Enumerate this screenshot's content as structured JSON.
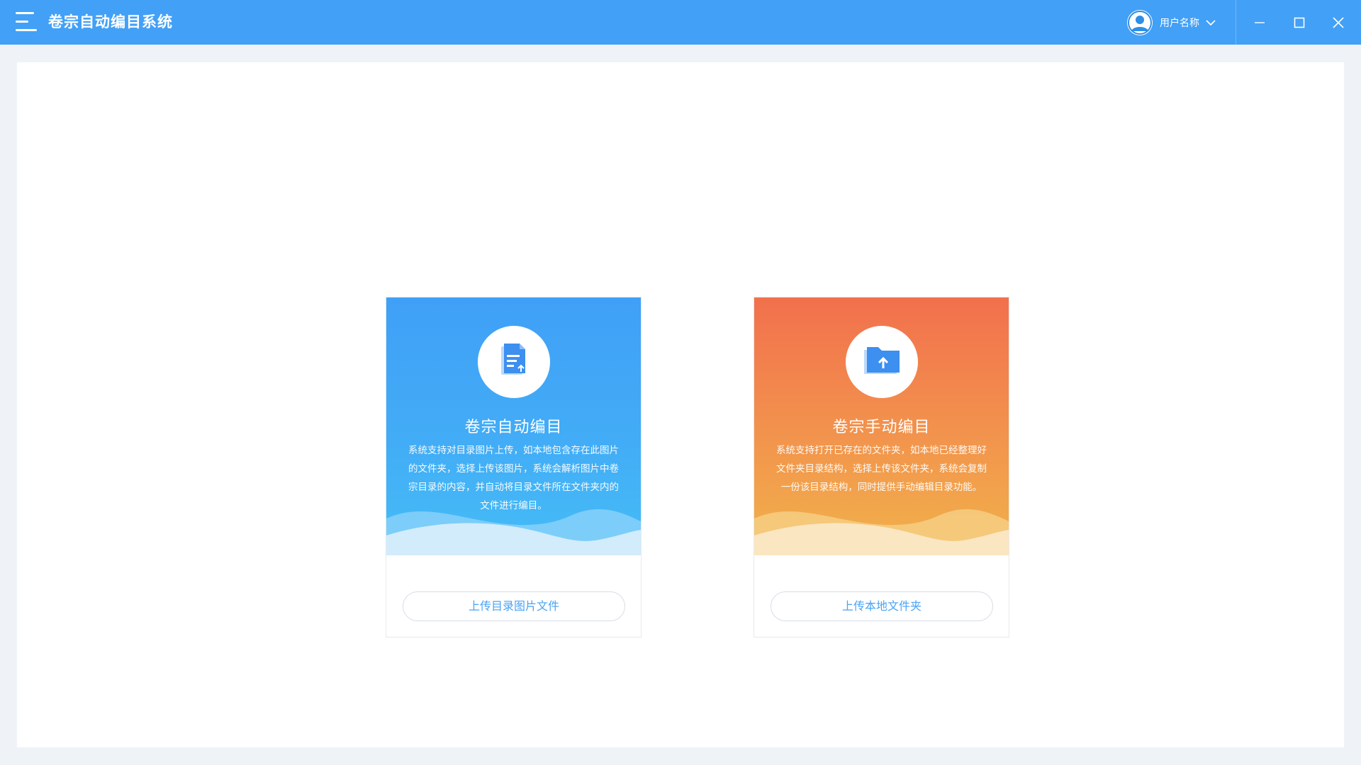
{
  "app": {
    "title": "卷宗自动编目系统",
    "accent_color": "#42a0f7"
  },
  "header": {
    "menu_icon": "hamburger-menu-icon",
    "user": {
      "avatar_icon": "user-avatar-icon",
      "name": "用户名称",
      "dropdown_icon": "chevron-down-icon"
    },
    "window_controls": [
      "minimize-icon",
      "maximize-icon",
      "close-icon"
    ]
  },
  "cards": [
    {
      "title": "卷宗自动编目",
      "description": "系统支持对目录图片上传，如本地包含存在此图片的文件夹，选择上传该图片，系统会解析图片中卷宗目录的内容，并自动将目录文件所在文件夹内的文件进行编目。",
      "button_label": "上传目录图片文件",
      "icon": "document-upload-icon",
      "theme": {
        "from": "#40a0f7",
        "to": "#45bdf7"
      }
    },
    {
      "title": "卷宗手动编目",
      "description": "系统支持打开已存在的文件夹，如本地已经整理好文件夹目录结构，选择上传该文件夹，系统会复制一份该目录结构，同时提供手动编辑目录功能。",
      "button_label": "上传本地文件夹",
      "icon": "folder-upload-icon",
      "theme": {
        "from": "#f2704d",
        "to": "#f1b24a"
      }
    }
  ]
}
